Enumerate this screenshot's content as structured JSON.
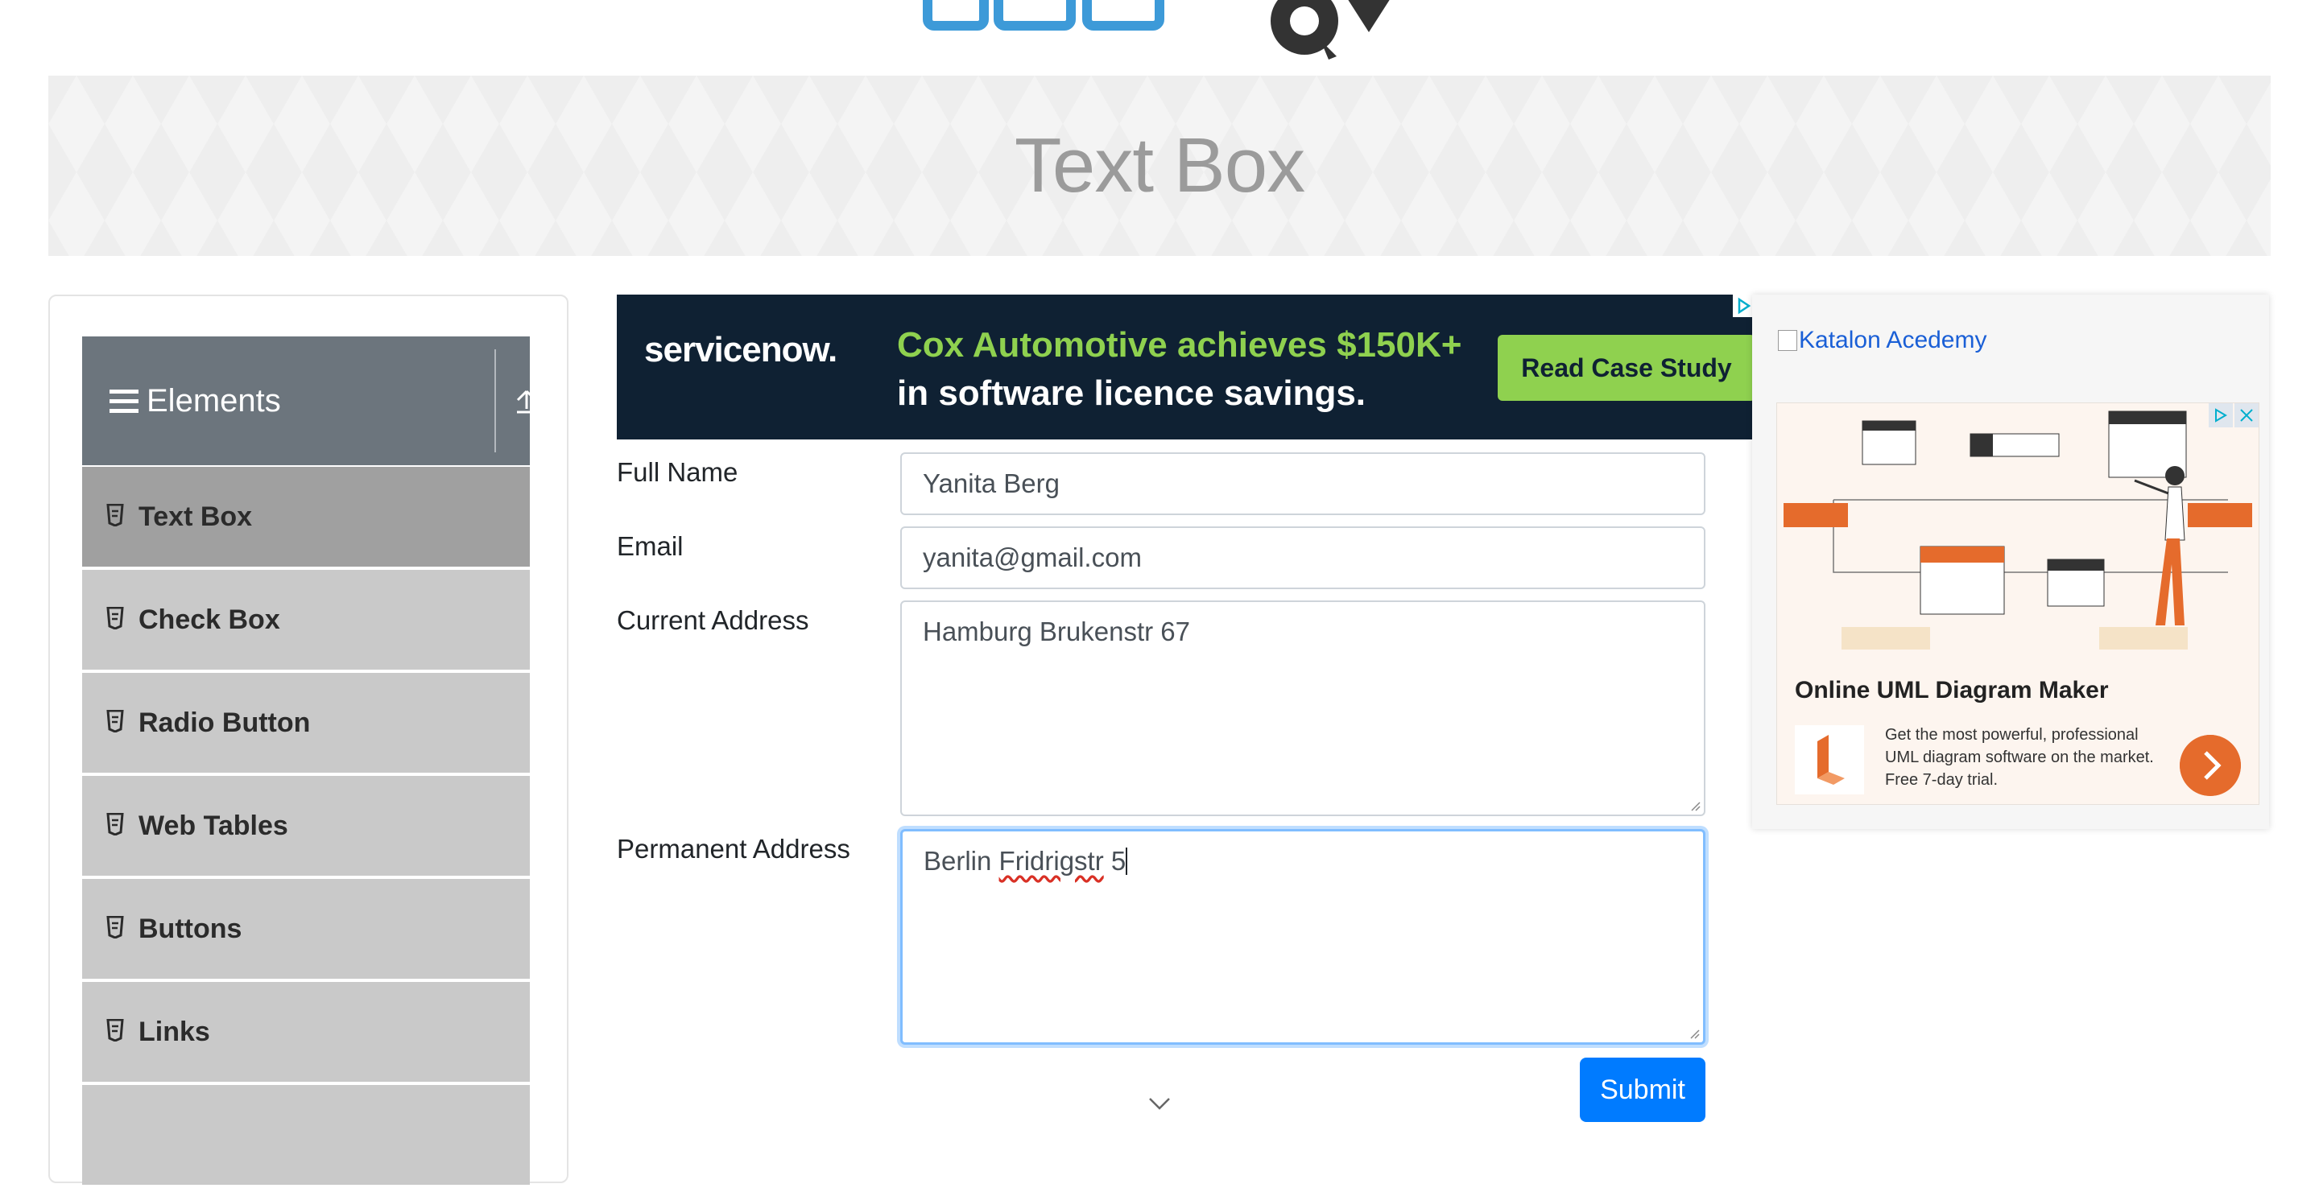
{
  "page": {
    "title": "Text Box"
  },
  "sidebar": {
    "group_title": "Elements",
    "items": [
      {
        "label": "Text Box",
        "active": true
      },
      {
        "label": "Check Box"
      },
      {
        "label": "Radio Button"
      },
      {
        "label": "Web Tables"
      },
      {
        "label": "Buttons"
      },
      {
        "label": "Links"
      }
    ]
  },
  "ad_top": {
    "brand": "servicenow.",
    "headline_line1": "Cox Automotive achieves $150K+",
    "headline_line2": "in software licence savings.",
    "cta": "Read Case Study",
    "colors": {
      "bg": "#0f2133",
      "accent": "#8fd14f"
    }
  },
  "form": {
    "full_name_label": "Full Name",
    "full_name_value": "Yanita Berg",
    "email_label": "Email",
    "email_value": "yanita@gmail.com",
    "current_address_label": "Current Address",
    "current_address_value": "Hamburg Brukenstr 67",
    "permanent_address_label": "Permanent Address",
    "permanent_address_prefix": "Berlin ",
    "permanent_address_misspelled": "Fridrigstr",
    "permanent_address_suffix": " 5",
    "submit_label": "Submit"
  },
  "ad_right": {
    "broken_image_alt": "Katalon Acedemy",
    "ad_title": "Online UML Diagram Maker",
    "ad_desc": "Get the most powerful, professional UML diagram software on the market. Free 7-day trial."
  },
  "icons": {
    "menu": "hamburger-icon",
    "collapse": "upload-icon",
    "item": "html5-icon",
    "scroll_hint": "chevron-down-icon"
  }
}
